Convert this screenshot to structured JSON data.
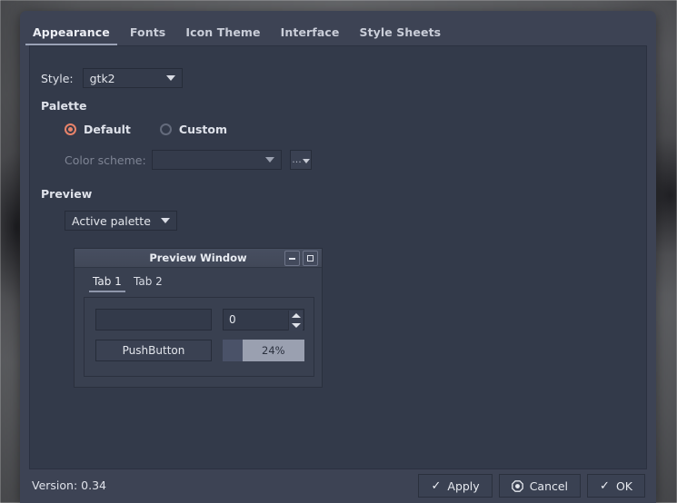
{
  "window": {
    "tabs": [
      {
        "label": "Appearance",
        "active": true
      },
      {
        "label": "Fonts",
        "active": false
      },
      {
        "label": "Icon Theme",
        "active": false
      },
      {
        "label": "Interface",
        "active": false
      },
      {
        "label": "Style Sheets",
        "active": false
      }
    ]
  },
  "appearance": {
    "style_label": "Style:",
    "style_value": "gtk2",
    "palette_heading": "Palette",
    "palette_default_label": "Default",
    "palette_custom_label": "Custom",
    "palette_selected": "Default",
    "color_scheme_label": "Color scheme:",
    "color_scheme_value": "",
    "color_scheme_browse_label": "...",
    "preview_heading": "Preview",
    "preview_mode_value": "Active palette"
  },
  "preview_window": {
    "title": "Preview Window",
    "minimize_label": "Minimize",
    "maximize_label": "Maximize",
    "tabs": [
      {
        "label": "Tab 1",
        "active": true
      },
      {
        "label": "Tab 2",
        "active": false
      }
    ],
    "line_edit_value": "",
    "spinbox_value": "0",
    "push_button_label": "PushButton",
    "progress_value": "24%",
    "progress_percent": 24
  },
  "footer": {
    "version_label": "Version: 0.34",
    "apply_label": "Apply",
    "cancel_label": "Cancel",
    "ok_label": "OK"
  },
  "colors": {
    "accent": "#e8836a",
    "dialog_bg": "#3d4354",
    "content_bg": "#333a4a",
    "text": "#dfe2ea",
    "text_disabled": "#7e8494"
  }
}
